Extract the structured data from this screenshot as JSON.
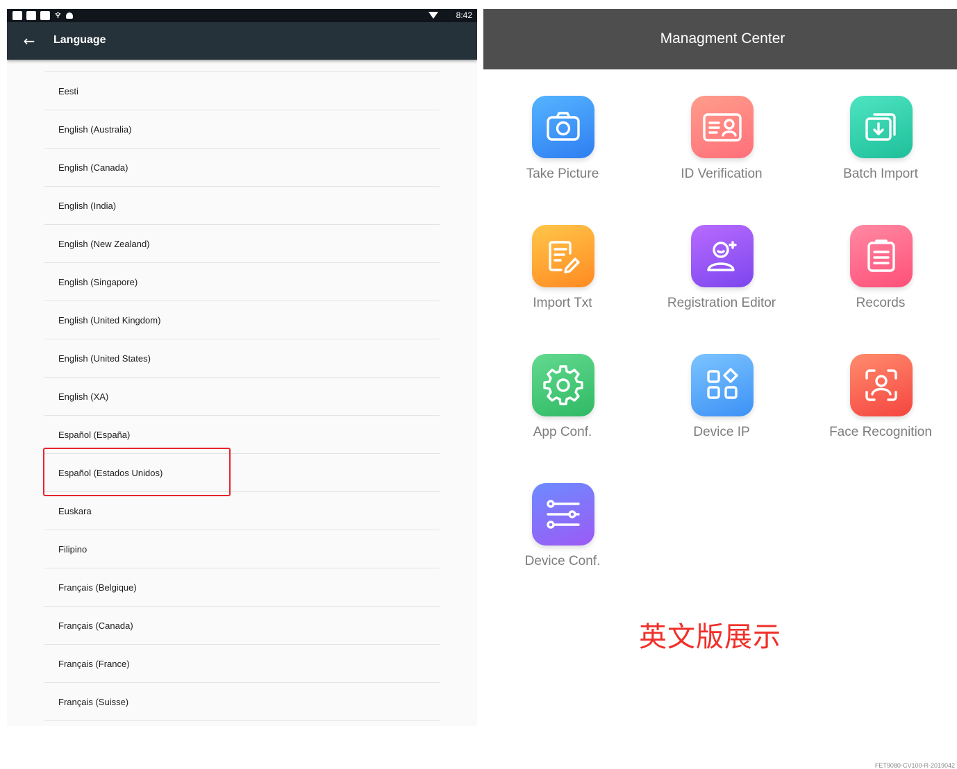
{
  "status_bar": {
    "time": "8:42",
    "usb_glyph": "♆"
  },
  "toolbar": {
    "back_glyph": "←",
    "title": "Language"
  },
  "languages": [
    "Eesti",
    "English (Australia)",
    "English (Canada)",
    "English (India)",
    "English (New Zealand)",
    "English (Singapore)",
    "English (United Kingdom)",
    "English (United States)",
    "English (XA)",
    "Español (España)",
    "Español (Estados Unidos)",
    "Euskara",
    "Filipino",
    "Français (Belgique)",
    "Français (Canada)",
    "Français (France)",
    "Français (Suisse)"
  ],
  "highlighted_language": "Español (Estados Unidos)",
  "highlight_color": "#e8252a",
  "management": {
    "title": "Managment Center",
    "tiles": [
      {
        "label": "Take Picture",
        "icon": "camera-icon",
        "color": "#3f94fa"
      },
      {
        "label": "ID Verification",
        "icon": "id-card-icon",
        "color": "#ff8682"
      },
      {
        "label": "Batch Import",
        "icon": "batch-import-icon",
        "color": "#2fd2ae"
      },
      {
        "label": "Import Txt",
        "icon": "import-txt-icon",
        "color": "#ffa636"
      },
      {
        "label": "Registration Editor",
        "icon": "registration-editor-icon",
        "color": "#9a58f6"
      },
      {
        "label": "Records",
        "icon": "records-icon",
        "color": "#ff6b8d"
      },
      {
        "label": "App Conf.",
        "icon": "app-conf-icon",
        "color": "#48c979"
      },
      {
        "label": "Device IP",
        "icon": "device-ip-icon",
        "color": "#5aa9fa"
      },
      {
        "label": "Face Recognition",
        "icon": "face-recognition-icon",
        "color": "#f9634f"
      },
      {
        "label": "Device Conf.",
        "icon": "device-conf-icon",
        "color": "#8472fa"
      }
    ]
  },
  "caption": "英文版展示",
  "caption_color": "#f0302a",
  "footer_code": "FET9080-CV100-R-2019042"
}
